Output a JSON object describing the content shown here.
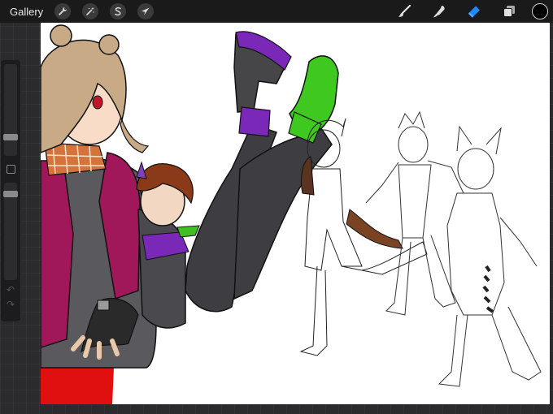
{
  "toolbar": {
    "gallery_label": "Gallery",
    "left_tools": [
      {
        "name": "actions",
        "icon": "wrench-icon"
      },
      {
        "name": "adjustments",
        "icon": "magic-wand-icon"
      },
      {
        "name": "selection",
        "icon": "selection-s-icon"
      },
      {
        "name": "transform",
        "icon": "arrow-cursor-icon"
      }
    ],
    "right_tools": [
      {
        "name": "brush",
        "icon": "brush-icon",
        "active": false
      },
      {
        "name": "smudge",
        "icon": "smudge-icon",
        "active": false
      },
      {
        "name": "eraser",
        "icon": "eraser-icon",
        "active": true
      },
      {
        "name": "layers",
        "icon": "layers-icon",
        "active": false
      }
    ],
    "current_color": "#000000",
    "active_tool_color": "#1e88ff"
  },
  "sidebar": {
    "brush_size_level": 0.32,
    "opacity_level": 0.2,
    "modify_button": "square-icon",
    "undo_icon": "undo-icon",
    "redo_icon": "redo-icon"
  },
  "canvas": {
    "background": "#ffffff",
    "artwork": "anime-character-illustration"
  }
}
